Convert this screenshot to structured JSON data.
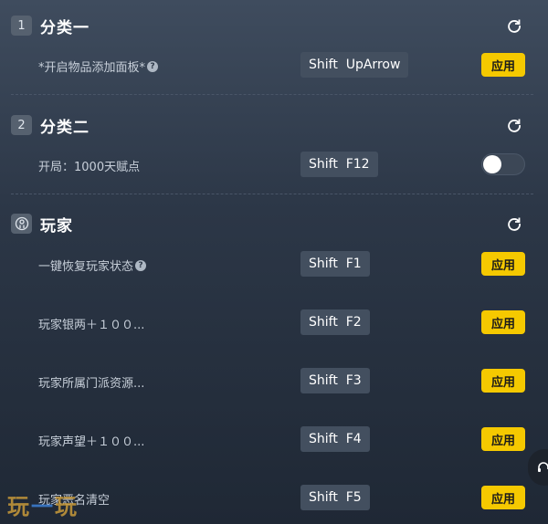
{
  "sections": [
    {
      "badge": "1",
      "title": "分类一",
      "rows": [
        {
          "label": "*开启物品添加面板*",
          "help": "?",
          "hotkey": "Shift  UpArrow",
          "action": "应用"
        }
      ]
    },
    {
      "badge": "2",
      "title": "分类二",
      "rows": [
        {
          "label": "开局：1000天赋点",
          "hotkey": "Shift  F12",
          "toggle_on": false
        }
      ]
    },
    {
      "badge_icon": "player-icon",
      "title": "玩家",
      "rows": [
        {
          "label": "一键恢复玩家状态",
          "help": "?",
          "hotkey": "Shift  F1",
          "action": "应用"
        },
        {
          "label": "玩家银两＋１００...",
          "hotkey": "Shift  F2",
          "action": "应用"
        },
        {
          "label": "玩家所属门派资源...",
          "hotkey": "Shift  F3",
          "action": "应用"
        },
        {
          "label": "玩家声望＋１００...",
          "hotkey": "Shift  F4",
          "action": "应用"
        },
        {
          "label": "玩家恶名清空",
          "hotkey": "Shift  F5",
          "action": "应用"
        }
      ]
    }
  ],
  "watermark": {
    "left": "玩",
    "mid": "一",
    "right": "玩"
  },
  "colors": {
    "accent": "#f5c900",
    "badge": "#56616f",
    "hotkey_bg": "#434f5f"
  }
}
